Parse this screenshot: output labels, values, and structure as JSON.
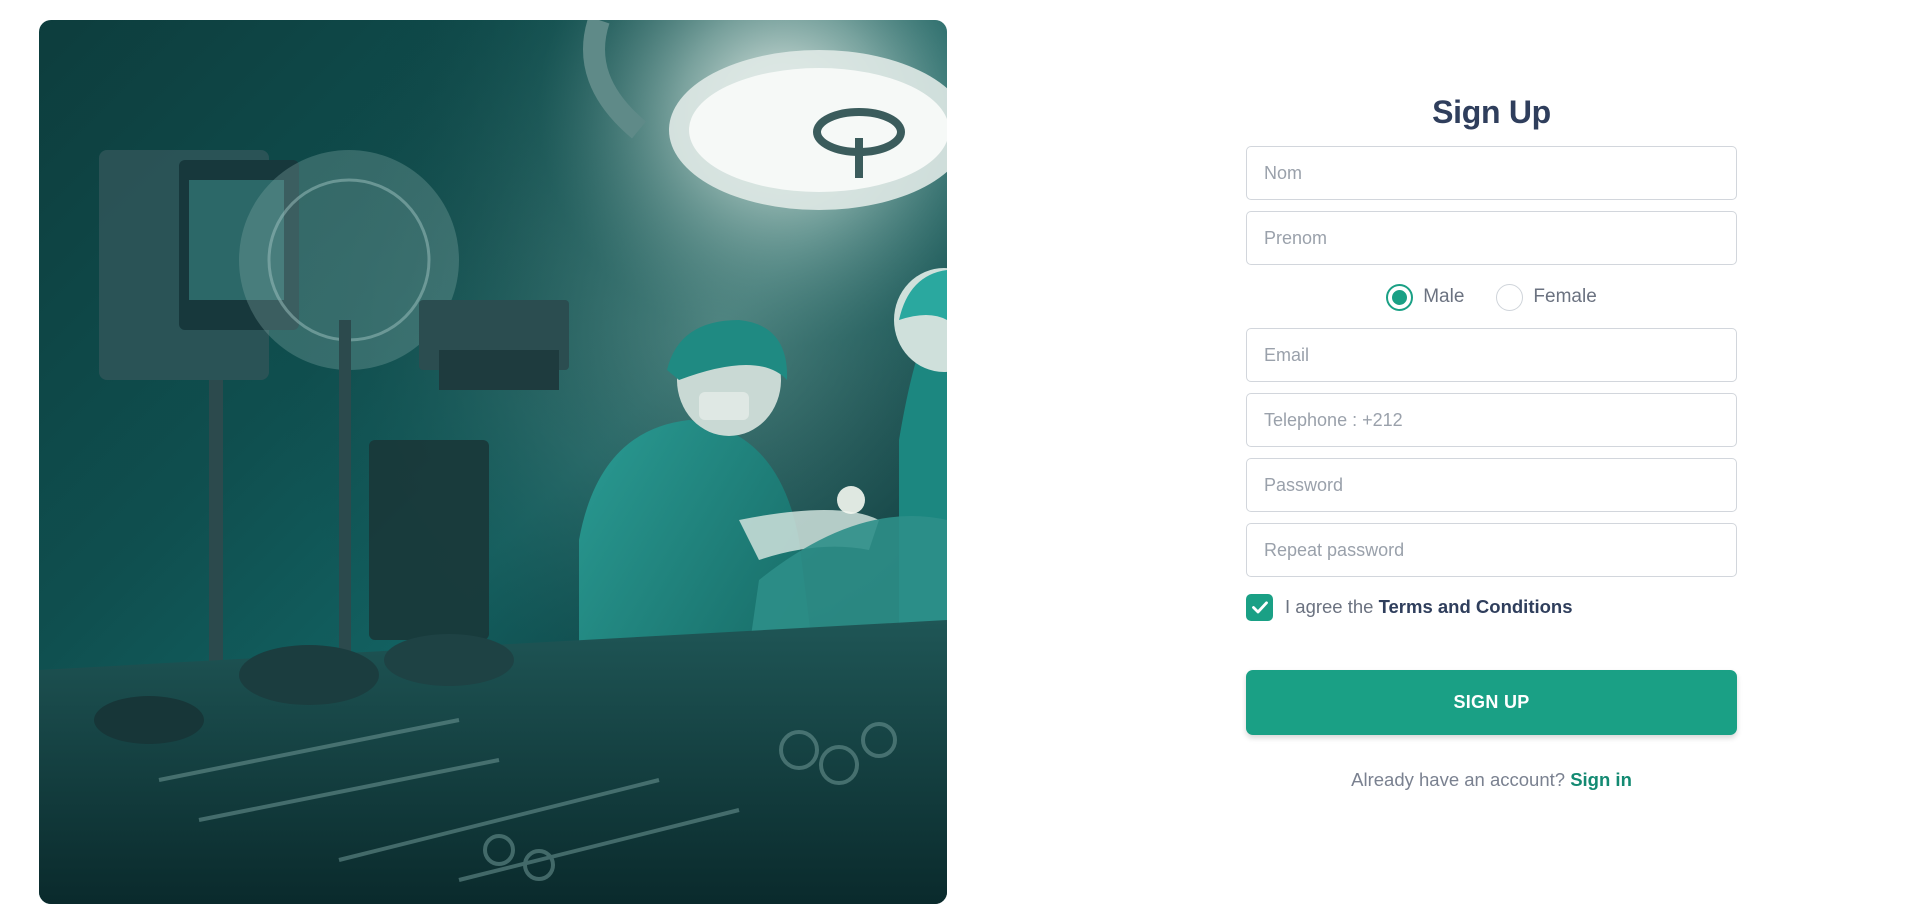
{
  "hero": {
    "description_icon": "operating-room-photo"
  },
  "form": {
    "title": "Sign Up",
    "nom_placeholder": "Nom",
    "prenom_placeholder": "Prenom",
    "gender": {
      "options": [
        "Male",
        "Female"
      ],
      "selected": "Male"
    },
    "email_placeholder": "Email",
    "telephone_placeholder": "Telephone : +212",
    "password_placeholder": "Password",
    "repeat_password_placeholder": "Repeat password",
    "terms": {
      "prefix": "I agree the ",
      "link": "Terms and Conditions",
      "checked": true
    },
    "submit_label": "SIGN UP",
    "signin": {
      "prompt": "Already have an account? ",
      "link": "Sign in"
    }
  },
  "colors": {
    "accent": "#1aa085",
    "title": "#2f3e5c",
    "link": "#138a72"
  }
}
